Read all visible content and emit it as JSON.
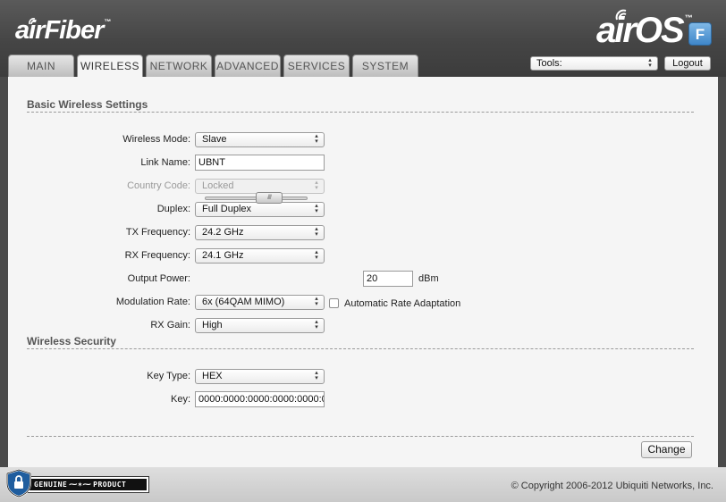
{
  "header": {
    "brand_left": "airFiber",
    "brand_left_tm": "™",
    "brand_right": "airOS",
    "brand_right_tm": "™",
    "badge": "F",
    "accent_color": "#3f86c9"
  },
  "tabs": [
    {
      "label": "MAIN",
      "active": false
    },
    {
      "label": "WIRELESS",
      "active": true
    },
    {
      "label": "NETWORK",
      "active": false
    },
    {
      "label": "ADVANCED",
      "active": false
    },
    {
      "label": "SERVICES",
      "active": false
    },
    {
      "label": "SYSTEM",
      "active": false
    }
  ],
  "tools": {
    "label": "Tools:"
  },
  "logout_label": "Logout",
  "basic": {
    "title": "Basic Wireless Settings",
    "wireless_mode": {
      "label": "Wireless Mode:",
      "value": "Slave"
    },
    "link_name": {
      "label": "Link Name:",
      "value": "UBNT"
    },
    "country_code": {
      "label": "Country Code:",
      "value": "Locked",
      "disabled": true
    },
    "duplex": {
      "label": "Duplex:",
      "value": "Full Duplex"
    },
    "tx_frequency": {
      "label": "TX Frequency:",
      "value": "24.2 GHz"
    },
    "rx_frequency": {
      "label": "RX Frequency:",
      "value": "24.1 GHz"
    },
    "output_power": {
      "label": "Output Power:",
      "value": "20",
      "unit": "dBm",
      "slider_level": 0.5
    },
    "modulation_rate": {
      "label": "Modulation Rate:",
      "value": "6x (64QAM MIMO)"
    },
    "auto_rate": {
      "label": "Automatic Rate Adaptation",
      "checked": false
    },
    "rx_gain": {
      "label": "RX Gain:",
      "value": "High"
    }
  },
  "security": {
    "title": "Wireless Security",
    "key_type": {
      "label": "Key Type:",
      "value": "HEX"
    },
    "key": {
      "label": "Key:",
      "value": "0000:0000:0000:0000:0000:0"
    }
  },
  "change_label": "Change",
  "footer": {
    "genuine_left": "GENUINE",
    "genuine_right": "PRODUCT",
    "copyright": "© Copyright 2006-2012 Ubiquiti Networks, Inc."
  }
}
